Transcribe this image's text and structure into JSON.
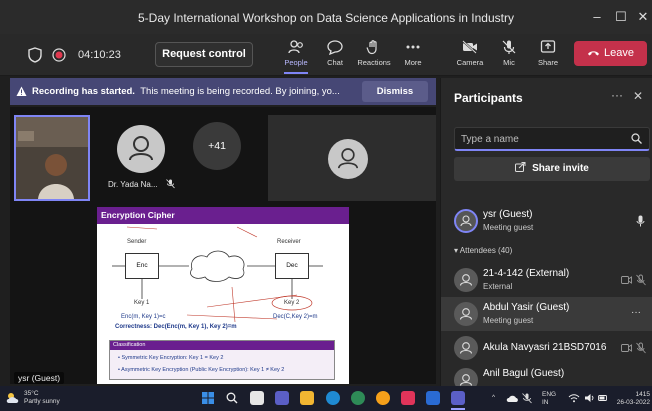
{
  "window": {
    "title": "5-Day International Workshop on Data Science Applications in Industry"
  },
  "toolbar": {
    "timer": "04:10:23",
    "request_control": "Request control",
    "people": "People",
    "chat": "Chat",
    "reactions": "Reactions",
    "more": "More",
    "camera": "Camera",
    "mic": "Mic",
    "share": "Share",
    "leave": "Leave"
  },
  "notification": {
    "bold": "Recording has started.",
    "text": "This meeting is being recorded. By joining, yo...",
    "dismiss": "Dismiss"
  },
  "stage": {
    "tile_name": "Dr. Yada Na...",
    "overflow_count": "+41",
    "presenter_label": "ysr (Guest)"
  },
  "slide": {
    "title": "Encryption Cipher",
    "sender": "Sender",
    "receiver": "Receiver",
    "enc": "Enc",
    "dec": "Dec",
    "key1": "Key 1",
    "key2": "Key 2",
    "enc_formula": "Enc(m, Key 1)=c",
    "dec_formula": "Dec(C,Key 2)=m",
    "correctness": "Correctness: Dec(Enc(m, Key 1), Key 2)=m",
    "classification": "Classification",
    "symmetric": "Symmetric Key Encryption: Key 1 = Key 2",
    "asymmetric": "Asymmetric Key Encryption (Public Key Encryption): Key 1 ≠ Key 2"
  },
  "participants": {
    "title": "Participants",
    "search_placeholder": "Type a name",
    "share_invite": "Share invite",
    "attendees_header": "Attendees (40)",
    "presenter": {
      "name": "ysr (Guest)",
      "role": "Meeting guest"
    },
    "attendees": [
      {
        "name": "21-4-142 (External)",
        "sub": "External"
      },
      {
        "name": "Abdul Yasir (Guest)",
        "sub": "Meeting guest"
      },
      {
        "name": "Akula Navyasri 21BSD7016",
        "sub": ""
      },
      {
        "name": "Anil Bagul (Guest)",
        "sub": ""
      }
    ]
  },
  "taskbar": {
    "temp": "35°C",
    "weather": "Partly sunny",
    "lang1": "ENG",
    "lang2": "IN",
    "time": "1415",
    "date": "26-03-2022"
  },
  "colors": {
    "accent": "#7f85f5",
    "leave": "#c4314b",
    "banner": "#464775",
    "slide_header": "#6a1f8f"
  }
}
